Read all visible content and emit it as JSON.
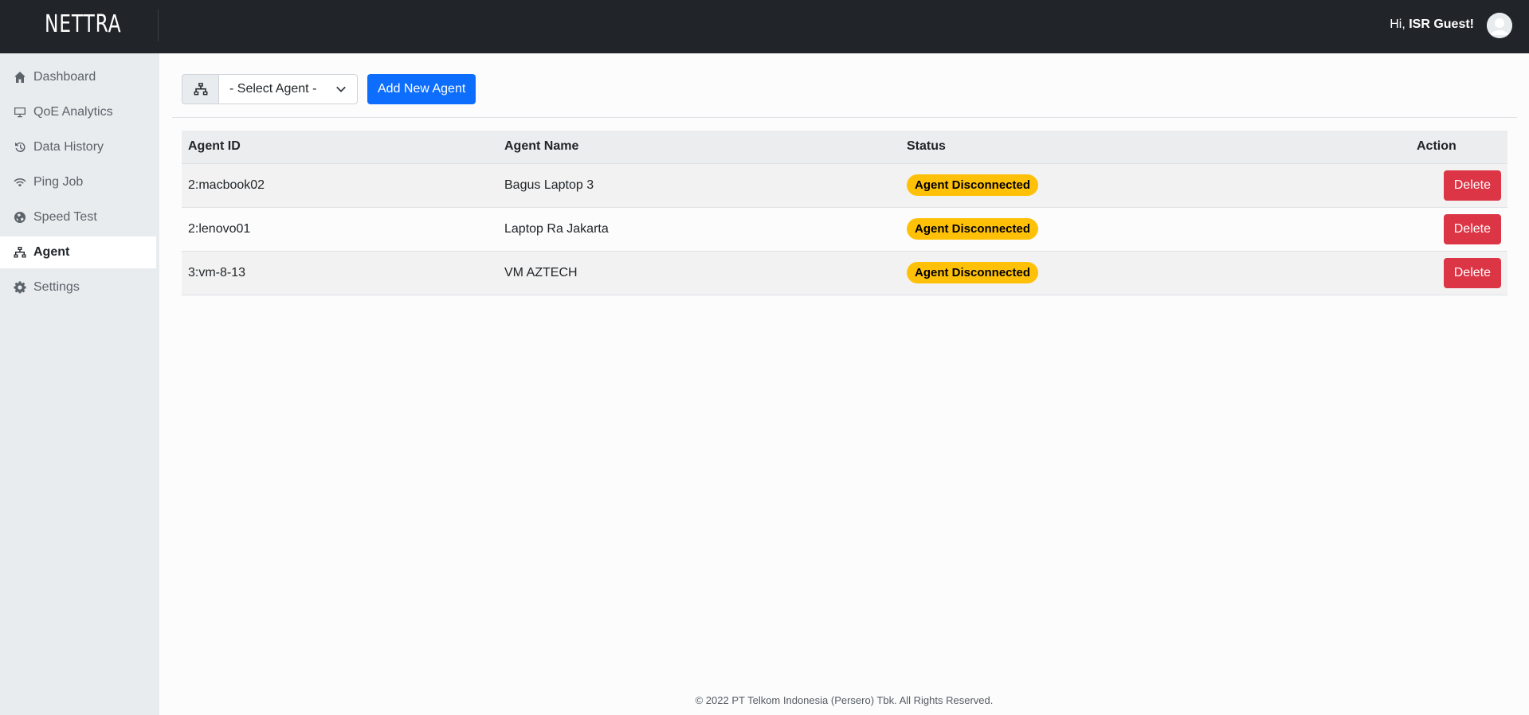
{
  "header": {
    "logo": "NETTRA",
    "greeting_prefix": "Hi, ",
    "user_name": "ISR Guest!"
  },
  "sidebar": {
    "items": [
      {
        "label": "Dashboard",
        "icon": "home-icon"
      },
      {
        "label": "QoE Analytics",
        "icon": "monitor-icon"
      },
      {
        "label": "Data History",
        "icon": "history-icon"
      },
      {
        "label": "Ping Job",
        "icon": "wifi-icon"
      },
      {
        "label": "Speed Test",
        "icon": "globe-icon"
      },
      {
        "label": "Agent",
        "icon": "network-icon",
        "active": true
      },
      {
        "label": "Settings",
        "icon": "gear-icon"
      }
    ]
  },
  "toolbar": {
    "select_value": "- Select Agent -",
    "add_button": "Add New Agent"
  },
  "table": {
    "headers": [
      "Agent ID",
      "Agent Name",
      "Status",
      "Action"
    ],
    "rows": [
      {
        "id": "2:macbook02",
        "name": "Bagus Laptop 3",
        "status": "Agent Disconnected",
        "action": "Delete"
      },
      {
        "id": "2:lenovo01",
        "name": "Laptop Ra Jakarta",
        "status": "Agent Disconnected",
        "action": "Delete"
      },
      {
        "id": "3:vm-8-13",
        "name": "VM AZTECH",
        "status": "Agent Disconnected",
        "action": "Delete"
      }
    ]
  },
  "footer": {
    "text": "© 2022 PT Telkom Indonesia (Persero) Tbk. All Rights Reserved."
  },
  "colors": {
    "topbar": "#212529",
    "primary": "#0d6efd",
    "danger": "#dc3545",
    "warning": "#ffc107"
  }
}
